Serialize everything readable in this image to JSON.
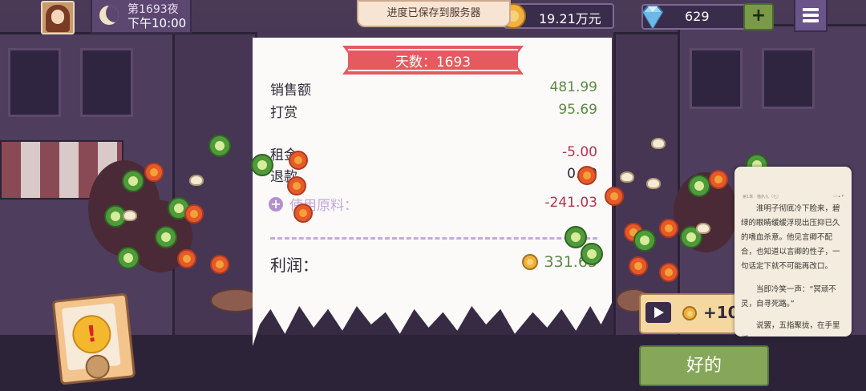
{
  "header": {
    "night_label": "第1693夜",
    "time_label": "下午10:00",
    "toast": "进度已保存到服务器",
    "money": "19.21万元",
    "gems": "629",
    "gem_add_label": "+"
  },
  "receipt": {
    "ribbon_title": "天数：1693",
    "rows": [
      {
        "label": "销售额",
        "value": "481.99"
      },
      {
        "label": "打赏",
        "value": "95.69"
      },
      {
        "label": "租金",
        "value": "-5.00"
      },
      {
        "label": "退款",
        "value": "0.00"
      },
      {
        "label": "使用原料：",
        "value": "-241.03"
      }
    ],
    "profit_label": "利润：",
    "profit_value": "331.65"
  },
  "ad_reward": {
    "label": "+10"
  },
  "ok_button": {
    "label": "好的"
  },
  "reader": {
    "header_left": "第1章 · 猫扒九（七）",
    "paragraphs": [
      "淮明子彻底冷下脸来，碧绿的眼睛缓缓浮现出压抑已久的嗜血杀意。他见言卿不配合，也知道以言卿的性子，一句话定下就不可能再改口。",
      "当即冷笑一声：“冥顽不灵，自寻死路。”",
      "说罢，五指聚拢，在手里缓"
    ]
  },
  "colors": {
    "income_green": "#5d8a45",
    "expense_red": "#b0354f",
    "ribbon_red": "#e45a60",
    "ok_green": "#86a75a"
  },
  "icons": [
    "avatar",
    "moon-icon",
    "coin-icon",
    "diamond-icon",
    "plus-icon",
    "menu-icon",
    "alert-icon",
    "play-icon",
    "add-ingredient-icon"
  ]
}
